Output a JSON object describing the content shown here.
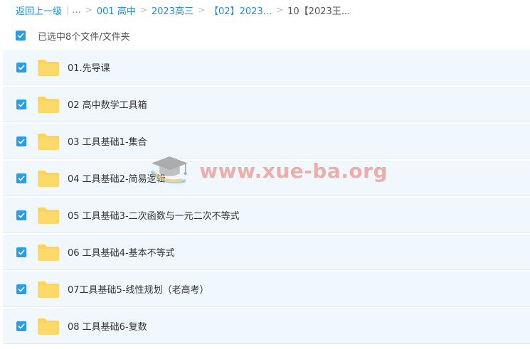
{
  "breadcrumb": {
    "back": "返回上一级",
    "ellipsis": "...",
    "items": [
      "001 高中",
      "2023高三",
      "【02】2023..."
    ],
    "current": "10【2023王..."
  },
  "selection": {
    "label": "已选中8个文件/文件夹"
  },
  "files": [
    {
      "name": "01.先导课"
    },
    {
      "name": "02 高中数学工具箱"
    },
    {
      "name": "03 工具基础1-集合"
    },
    {
      "name": "04 工具基础2-简易逻辑"
    },
    {
      "name": "05 工具基础3-二次函数与一元二次不等式"
    },
    {
      "name": "06 工具基础4-基本不等式"
    },
    {
      "name": "07工具基础5-线性规划（老高考）"
    },
    {
      "name": "08 工具基础6-复数"
    }
  ],
  "watermark": {
    "text": "www.xue-ba.org"
  },
  "colors": {
    "link": "#1e8fd6",
    "checkbox": "#2b9ce8",
    "row_bg": "#f0f8fd",
    "folder": "#fcd45a",
    "watermark": "#ec8076"
  },
  "icons": {
    "checkbox": "checkmark-icon",
    "folder": "folder-icon",
    "watermark_logo": "graduation-cap-icon"
  }
}
